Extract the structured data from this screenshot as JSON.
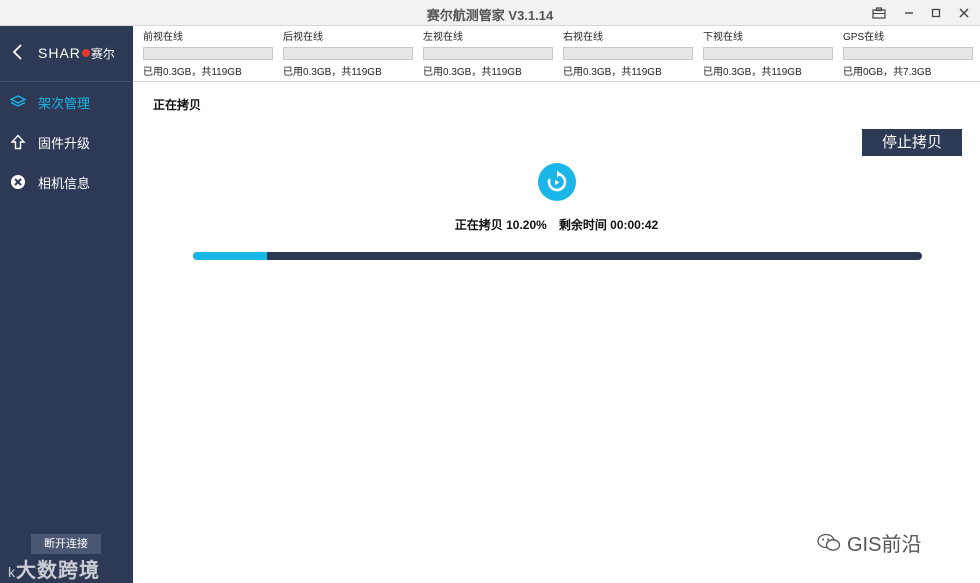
{
  "window": {
    "title": "赛尔航测管家 V3.1.14"
  },
  "sidebar": {
    "brand_text": "SHAR",
    "brand_cn": "赛尔",
    "items": [
      {
        "label": "架次管理",
        "icon": "layers-icon",
        "active": true
      },
      {
        "label": "固件升级",
        "icon": "upload-arrow-icon",
        "active": false
      },
      {
        "label": "相机信息",
        "icon": "camera-info-icon",
        "active": false
      }
    ],
    "disconnect_label": "断开连接",
    "watermark_text": "大数跨境",
    "watermark_prefix": "k"
  },
  "status": [
    {
      "label": "前视在线",
      "usage": "已用0.3GB，共119GB"
    },
    {
      "label": "后视在线",
      "usage": "已用0.3GB，共119GB"
    },
    {
      "label": "左视在线",
      "usage": "已用0.3GB，共119GB"
    },
    {
      "label": "右视在线",
      "usage": "已用0.3GB，共119GB"
    },
    {
      "label": "下视在线",
      "usage": "已用0.3GB，共119GB"
    },
    {
      "label": "GPS在线",
      "usage": "已用0GB，共7.3GB"
    }
  ],
  "main": {
    "section_title": "正在拷贝",
    "stop_button": "停止拷贝",
    "progress_label": "正在拷贝 10.20%",
    "remaining_label": "剩余时间 00:00:42",
    "progress_fraction": 0.102
  },
  "watermark_right": "GIS前沿",
  "colors": {
    "sidebar_bg": "#2e3a55",
    "accent": "#1ab6e8",
    "brand_red": "#e03a2f"
  }
}
